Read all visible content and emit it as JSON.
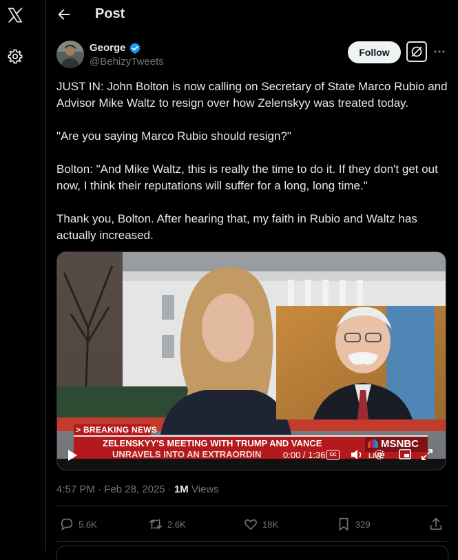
{
  "nav": {
    "logo_icon": "x-logo-icon",
    "settings_icon": "gear-icon"
  },
  "header": {
    "back_icon": "arrow-left-icon",
    "title": "Post"
  },
  "author": {
    "name": "George",
    "handle": "@BehizyTweets",
    "verified_color": "#1d9bf0",
    "follow_label": "Follow"
  },
  "tweet": {
    "paragraphs": [
      "JUST IN: John Bolton is now calling on Secretary of State Marco Rubio and Advisor Mike Waltz to resign over how Zelenskyy was treated today.",
      "\"Are you saying Marco Rubio should resign?\"",
      "Bolton: \"And Mike Waltz, this is really the time to do it. If they don't get out now, I think their reputations will suffer for a long, long time.\"",
      "Thank you, Bolton. After hearing that, my faith in Rubio and Waltz has actually increased."
    ]
  },
  "video": {
    "breaking_label": "> BREAKING NEWS",
    "headline_line1": "ZELENSKYY'S MEETING WITH TRUMP AND VANCE",
    "headline_line2": "UNRAVELS INTO AN EXTRAORDIN",
    "network": "MSNBC",
    "live_label": "LIVE",
    "time_display": "0:00 / 1:36",
    "cc_label": "CC"
  },
  "meta": {
    "time": "4:57 PM",
    "date": "Feb 28, 2025",
    "views_count": "1M",
    "views_label": "Views"
  },
  "actions": {
    "replies": "5.6K",
    "reposts": "2.6K",
    "likes": "18K",
    "bookmarks": "329"
  },
  "colors": {
    "background": "#000000",
    "text": "#e7e9ea",
    "muted": "#71767b",
    "accent": "#1d9bf0",
    "breaking_red": "#b4191c"
  }
}
